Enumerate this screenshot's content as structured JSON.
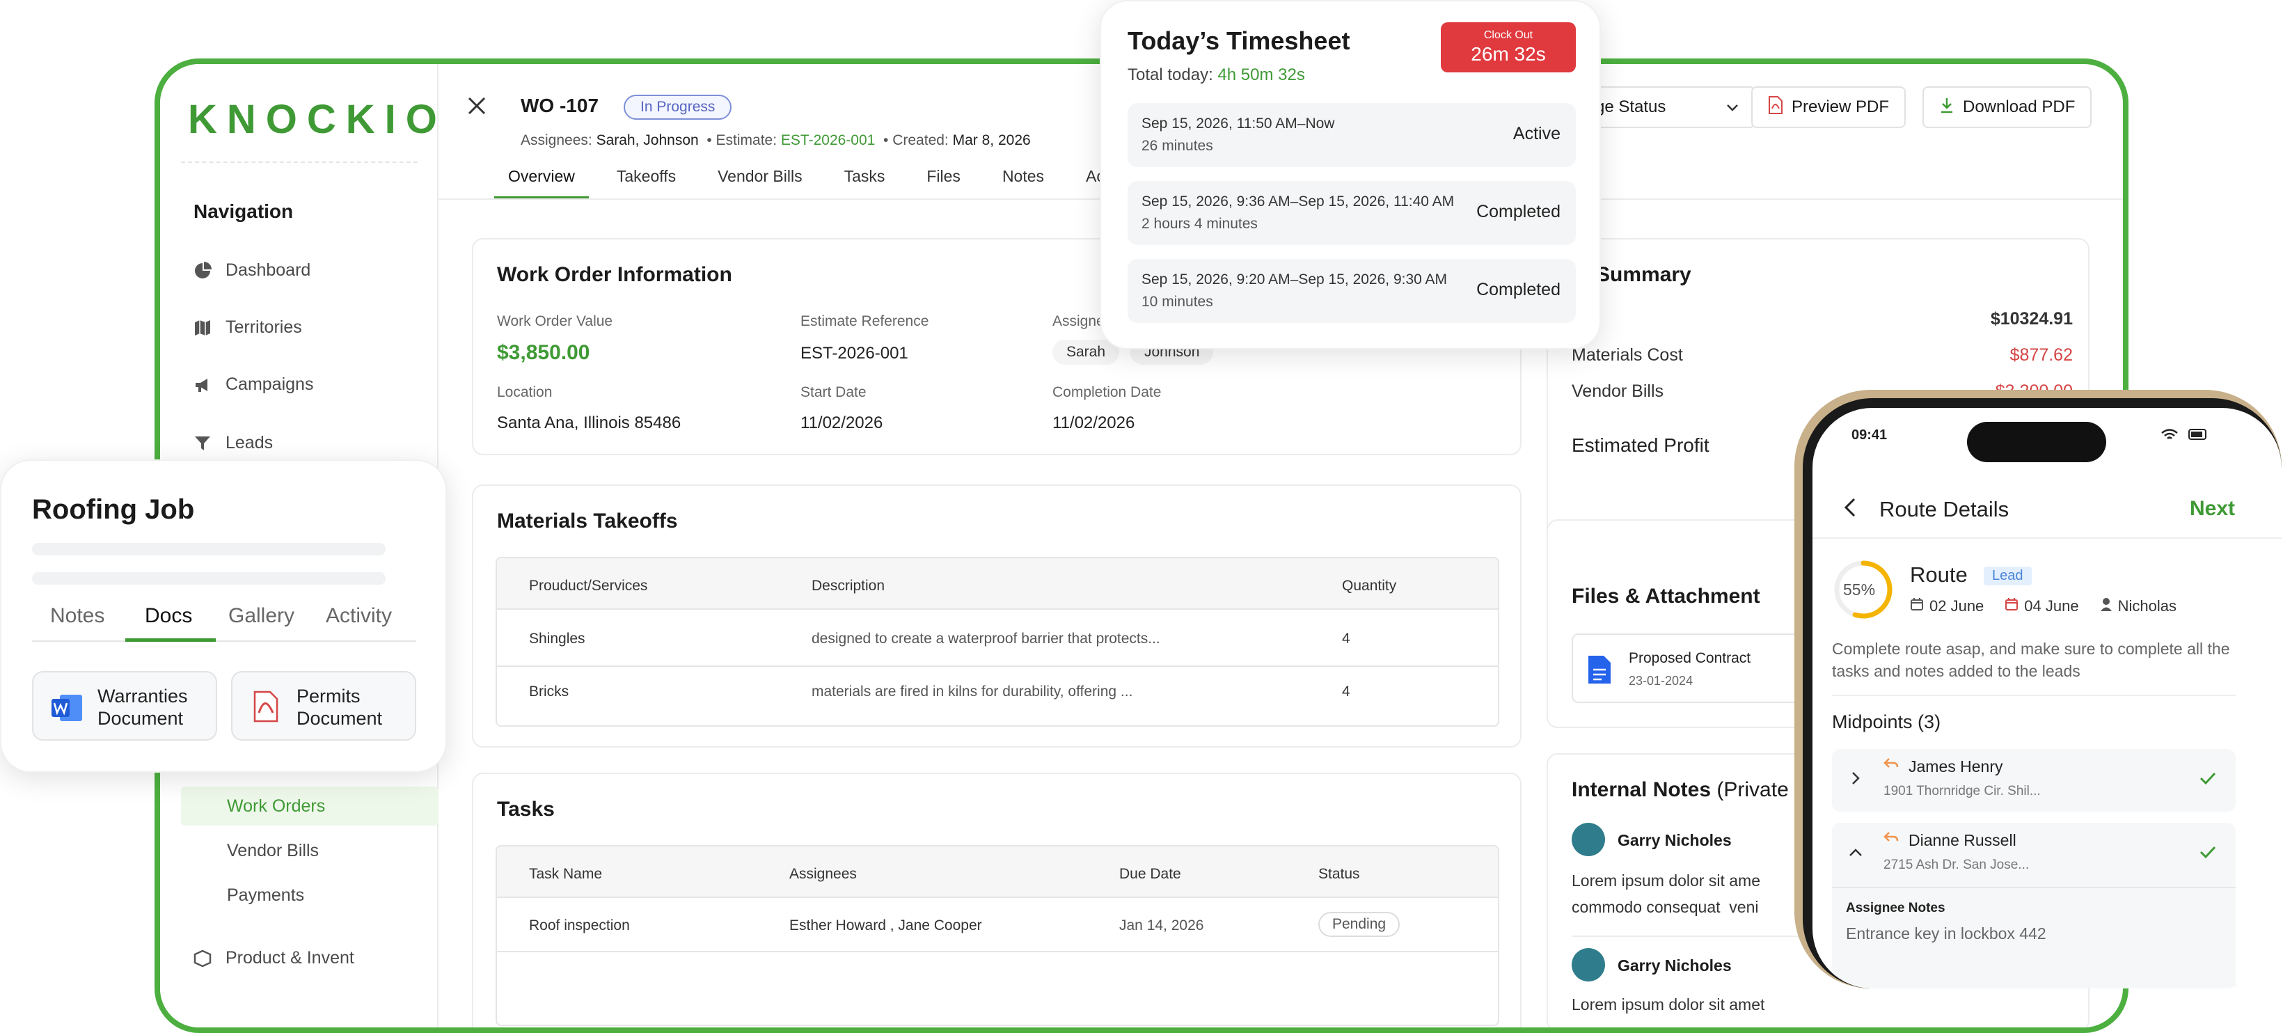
{
  "app": {
    "logo": "KNOCKIO"
  },
  "navigation": {
    "title": "Navigation",
    "items": [
      {
        "label": "Dashboard",
        "icon": "pie-chart-icon"
      },
      {
        "label": "Territories",
        "icon": "map-icon"
      },
      {
        "label": "Campaigns",
        "icon": "megaphone-icon"
      },
      {
        "label": "Leads",
        "icon": "funnel-icon"
      }
    ],
    "sub_items": [
      "Work Orders",
      "Vendor Bills",
      "Payments"
    ],
    "partial_item": "Product & Invent"
  },
  "work_order": {
    "title": "WO -107",
    "status": "In Progress",
    "assignees_label": "Assignees:",
    "assignees": "Sarah, Johnson",
    "estimate_label": "• Estimate:",
    "estimate": "EST-2026-001",
    "created_label": "• Created:",
    "created": "Mar 8, 2026",
    "tabs": [
      "Overview",
      "Takeoffs",
      "Vendor Bills",
      "Tasks",
      "Files",
      "Notes",
      "Ac"
    ],
    "buttons": {
      "status": "ge Status",
      "preview": "Preview PDF",
      "download": "Download PDF"
    }
  },
  "info_card": {
    "title": "Work Order Information",
    "fields": {
      "value_label": "Work Order Value",
      "value": "$3,850.00",
      "estimate_label": "Estimate Reference",
      "estimate": "EST-2026-001",
      "assignees_label": "Assigne",
      "assignee_1": "Sarah",
      "assignee_2": "Johnson",
      "location_label": "Location",
      "location": "Santa Ana, Illinois 85486",
      "start_label": "Start Date",
      "start": "11/02/2026",
      "completion_label": "Completion Date",
      "completion": "11/02/2026"
    }
  },
  "materials": {
    "title": "Materials Takeoffs",
    "headers": [
      "Prouduct/Services",
      "Description",
      "Quantity"
    ],
    "rows": [
      {
        "product": "Shingles",
        "description": "designed to create a waterproof barrier that protects...",
        "quantity": "4"
      },
      {
        "product": "Bricks",
        "description": "materials are fired in kilns for durability, offering ...",
        "quantity": "4"
      }
    ]
  },
  "tasks": {
    "title": "Tasks",
    "headers": [
      "Task Name",
      "Assignees",
      "Due Date",
      "Status"
    ],
    "rows": [
      {
        "name": "Roof inspection",
        "assignees": "Esther Howard , Jane Cooper",
        "due": "Jan 14, 2026",
        "status": "Pending"
      }
    ]
  },
  "cost_summary": {
    "title": "st Summary",
    "rows": [
      {
        "label": "otal",
        "value": "$10324.91",
        "color": "#1b1b1b"
      },
      {
        "label": "Materials Cost",
        "value": "$877.62",
        "color": "#d64545"
      },
      {
        "label": "Vendor Bills",
        "value": "$3,200.00",
        "color": "#d64545"
      }
    ],
    "profit_label": "Estimated Profit"
  },
  "files": {
    "title": "Files & Attachment",
    "file_name": "Proposed Contract",
    "file_date": "23-01-2024"
  },
  "internal_notes": {
    "title": "Internal Notes",
    "title_suffix": "(Private",
    "notes": [
      {
        "author": "Garry Nicholes",
        "line1": "Lorem ipsum dolor sit ame",
        "line2": "commodo consequat  veni"
      },
      {
        "author": "Garry Nicholes",
        "line1": "Lorem ipsum dolor sit amet"
      }
    ]
  },
  "timesheet": {
    "title": "Today’s Timesheet",
    "total_label": "Total today:",
    "total": "4h 50m 32s",
    "clock_out_label": "Clock Out",
    "clock_out_time": "26m 32s",
    "entries": [
      {
        "range": "Sep 15, 2026, 11:50 AM–Now",
        "duration": "26 minutes",
        "status": "Active"
      },
      {
        "range": "Sep 15, 2026, 9:36 AM–Sep 15, 2026, 11:40 AM",
        "duration": "2 hours 4 minutes",
        "status": "Completed"
      },
      {
        "range": "Sep 15, 2026, 9:20 AM–Sep 15, 2026, 9:30 AM",
        "duration": "10 minutes",
        "status": "Completed"
      }
    ]
  },
  "roofing": {
    "title": "Roofing Job",
    "tabs": [
      "Notes",
      "Docs",
      "Gallery",
      "Activity"
    ],
    "active_tab": "Docs",
    "docs": [
      {
        "line1": "Warranties",
        "line2": "Document",
        "icon": "word-icon"
      },
      {
        "line1": "Permits",
        "line2": "Document",
        "icon": "pdf-icon"
      }
    ]
  },
  "phone": {
    "time": "09:41",
    "header": "Route Details",
    "next": "Next",
    "progress": 55,
    "progress_label": "55%",
    "route_title": "Route",
    "route_badge": "Lead",
    "start_date": "02 June",
    "end_date": "04 June",
    "person": "Nicholas",
    "description": "Complete route asap, and make sure to complete all the tasks and notes added to the leads",
    "midpoints_title": "Midpoints (3)",
    "midpoints": [
      {
        "name": "James Henry",
        "address": "1901 Thornridge Cir. Shil..."
      },
      {
        "name": "Dianne Russell",
        "address": "2715 Ash Dr. San Jose..."
      }
    ],
    "assignee_notes_label": "Assignee Notes",
    "assignee_notes": "Entrance key in lockbox 442"
  }
}
